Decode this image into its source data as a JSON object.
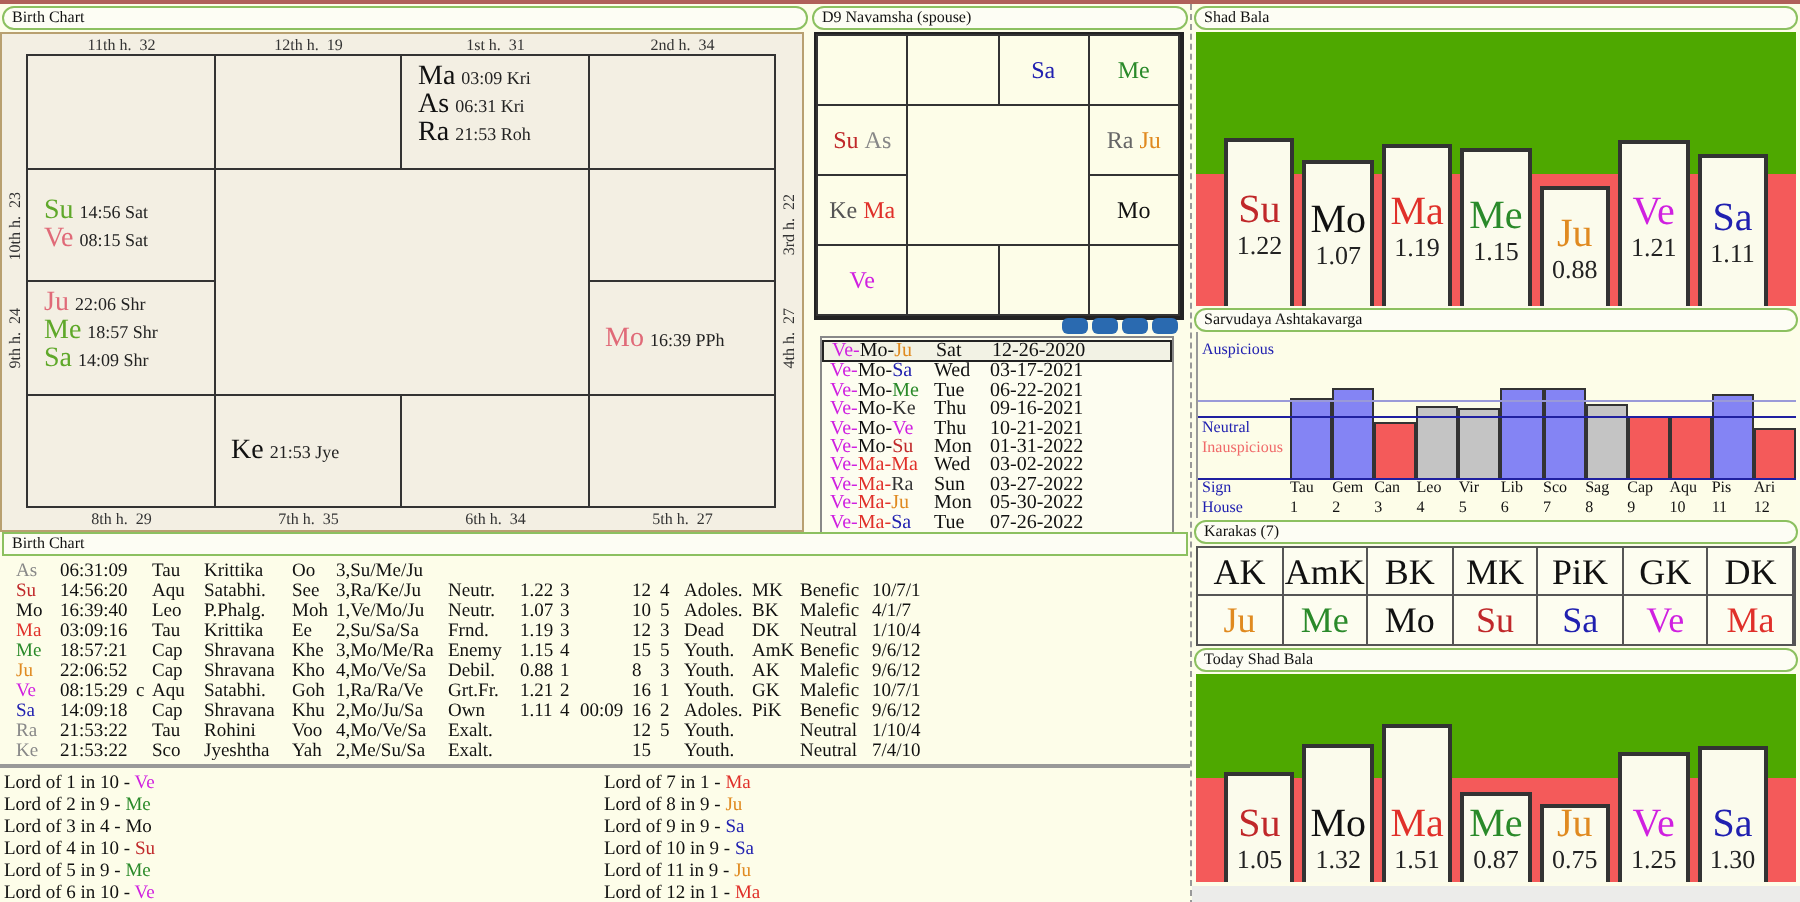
{
  "birth_chart": {
    "title": "Birth Chart",
    "houses": [
      {
        "label": "11th h.  32"
      },
      {
        "label": "12th h.  19"
      },
      {
        "label": "1st h.  31",
        "planets": [
          {
            "abbr": "Ma",
            "detail": "03:09 Kri",
            "color": "#111111"
          },
          {
            "abbr": "As",
            "detail": "06:31 Kri",
            "color": "#111111"
          },
          {
            "abbr": "Ra",
            "detail": "21:53 Roh",
            "color": "#111111"
          }
        ]
      },
      {
        "label": "2nd h.  34"
      },
      {
        "label": "10th h.  23",
        "planets": [
          {
            "abbr": "Su",
            "detail": "14:56 Sat",
            "color": "#5fa82a"
          },
          {
            "abbr": "Ve",
            "detail": "08:15 Sat",
            "color": "#e06a78"
          }
        ]
      },
      {
        "label": "3rd h.  22"
      },
      {
        "label": "9th h.  24",
        "planets": [
          {
            "abbr": "Ju",
            "detail": "22:06 Shr",
            "color": "#e06a78"
          },
          {
            "abbr": "Me",
            "detail": "18:57 Shr",
            "color": "#5fa82a"
          },
          {
            "abbr": "Sa",
            "detail": "14:09 Shr",
            "color": "#5fa82a"
          }
        ]
      },
      {
        "label": "4th h.  27",
        "planets": [
          {
            "abbr": "Mo",
            "detail": "16:39 PPh",
            "color": "#e06a78"
          }
        ]
      },
      {
        "label": "8th h.  29"
      },
      {
        "label": "7th h.  35",
        "planets": [
          {
            "abbr": "Ke",
            "detail": "21:53 Jye",
            "color": "#111111"
          }
        ]
      },
      {
        "label": "6th h.  34"
      },
      {
        "label": "5th h.  27"
      }
    ]
  },
  "navamsha": {
    "title": "D9 Navamsha  (spouse)",
    "houses": [
      {
        "planets": [
          {
            "abbr": "Sa",
            "color": "#2020b0"
          }
        ]
      },
      {
        "planets": [
          {
            "abbr": "Me",
            "color": "#2a8a2a"
          }
        ]
      },
      {
        "planets": [
          {
            "abbr": "Su",
            "color": "#c0282a"
          },
          {
            "abbr": "As",
            "color": "#888888"
          }
        ]
      },
      {
        "planets": [
          {
            "abbr": "Ra",
            "color": "#666666"
          },
          {
            "abbr": "Ju",
            "color": "#e08a20"
          }
        ]
      },
      {
        "planets": [
          {
            "abbr": "Ke",
            "color": "#555555"
          },
          {
            "abbr": "Ma",
            "color": "#e0302a"
          }
        ]
      },
      {
        "planets": [
          {
            "abbr": "Mo",
            "color": "#111111"
          }
        ]
      },
      {
        "planets": [
          {
            "abbr": "Ve",
            "color": "#d020e0"
          }
        ]
      }
    ]
  },
  "dasha": {
    "rows": [
      {
        "selected": true,
        "lords": [
          {
            "abbr": "Ve-",
            "color": "#d020e0"
          },
          {
            "abbr": "Mo-",
            "color": "#111111"
          },
          {
            "abbr": "Ju",
            "color": "#e08a20"
          }
        ],
        "day": "Sat",
        "date": "12-26-2020"
      },
      {
        "selected": false,
        "lords": [
          {
            "abbr": "Ve-",
            "color": "#d020e0"
          },
          {
            "abbr": "Mo-",
            "color": "#111111"
          },
          {
            "abbr": "Sa",
            "color": "#2020b0"
          }
        ],
        "day": "Wed",
        "date": "03-17-2021"
      },
      {
        "selected": false,
        "lords": [
          {
            "abbr": "Ve-",
            "color": "#d020e0"
          },
          {
            "abbr": "Mo-",
            "color": "#111111"
          },
          {
            "abbr": "Me",
            "color": "#2a8a2a"
          }
        ],
        "day": "Tue",
        "date": "06-22-2021"
      },
      {
        "selected": false,
        "lords": [
          {
            "abbr": "Ve-",
            "color": "#d020e0"
          },
          {
            "abbr": "Mo-",
            "color": "#111111"
          },
          {
            "abbr": "Ke",
            "color": "#333333"
          }
        ],
        "day": "Thu",
        "date": "09-16-2021"
      },
      {
        "selected": false,
        "lords": [
          {
            "abbr": "Ve-",
            "color": "#d020e0"
          },
          {
            "abbr": "Mo-",
            "color": "#111111"
          },
          {
            "abbr": "Ve",
            "color": "#d020e0"
          }
        ],
        "day": "Thu",
        "date": "10-21-2021"
      },
      {
        "selected": false,
        "lords": [
          {
            "abbr": "Ve-",
            "color": "#d020e0"
          },
          {
            "abbr": "Mo-",
            "color": "#111111"
          },
          {
            "abbr": "Su",
            "color": "#c0282a"
          }
        ],
        "day": "Mon",
        "date": "01-31-2022"
      },
      {
        "selected": false,
        "lords": [
          {
            "abbr": "Ve-",
            "color": "#d020e0"
          },
          {
            "abbr": "Ma-",
            "color": "#e0302a"
          },
          {
            "abbr": "Ma",
            "color": "#e0302a"
          }
        ],
        "day": "Wed",
        "date": "03-02-2022"
      },
      {
        "selected": false,
        "lords": [
          {
            "abbr": "Ve-",
            "color": "#d020e0"
          },
          {
            "abbr": "Ma-",
            "color": "#e0302a"
          },
          {
            "abbr": "Ra",
            "color": "#333333"
          }
        ],
        "day": "Sun",
        "date": "03-27-2022"
      },
      {
        "selected": false,
        "lords": [
          {
            "abbr": "Ve-",
            "color": "#d020e0"
          },
          {
            "abbr": "Ma-",
            "color": "#e0302a"
          },
          {
            "abbr": "Ju",
            "color": "#e08a20"
          }
        ],
        "day": "Mon",
        "date": "05-30-2022"
      },
      {
        "selected": false,
        "lords": [
          {
            "abbr": "Ve-",
            "color": "#d020e0"
          },
          {
            "abbr": "Ma-",
            "color": "#e0302a"
          },
          {
            "abbr": "Sa",
            "color": "#2020b0"
          }
        ],
        "day": "Tue",
        "date": "07-26-2022"
      }
    ]
  },
  "shad_bala": {
    "title": "Shad Bala",
    "bars": [
      {
        "abbr": "Su",
        "value": "1.22",
        "level": 0.61,
        "color": "#c0282a"
      },
      {
        "abbr": "Mo",
        "value": "1.07",
        "level": 0.535,
        "color": "#111111"
      },
      {
        "abbr": "Ma",
        "value": "1.19",
        "level": 0.595,
        "color": "#e0302a"
      },
      {
        "abbr": "Me",
        "value": "1.15",
        "level": 0.575,
        "color": "#2a8a2a"
      },
      {
        "abbr": "Ju",
        "value": "0.88",
        "level": 0.44,
        "color": "#e08a20"
      },
      {
        "abbr": "Ve",
        "value": "1.21",
        "level": 0.605,
        "color": "#d020e0"
      },
      {
        "abbr": "Sa",
        "value": "1.11",
        "level": 0.555,
        "color": "#2020b0"
      }
    ]
  },
  "ashtakavarga": {
    "title": "Sarvudaya Ashtakavarga",
    "zones": [
      "Auspicious",
      "Neutral",
      "Inauspicious"
    ],
    "sign_label": "Sign",
    "house_label": "House",
    "bars": [
      {
        "sign": "Tau",
        "house": "1",
        "kind": "auspicious",
        "level": 0.55
      },
      {
        "sign": "Gem",
        "house": "2",
        "kind": "auspicious",
        "level": 0.61
      },
      {
        "sign": "Can",
        "house": "3",
        "kind": "inauspicious",
        "level": 0.39
      },
      {
        "sign": "Leo",
        "house": "4",
        "kind": "neutral",
        "level": 0.49
      },
      {
        "sign": "Vir",
        "house": "5",
        "kind": "neutral",
        "level": 0.48
      },
      {
        "sign": "Lib",
        "house": "6",
        "kind": "auspicious",
        "level": 0.61
      },
      {
        "sign": "Sco",
        "house": "7",
        "kind": "auspicious",
        "level": 0.62
      },
      {
        "sign": "Sag",
        "house": "8",
        "kind": "neutral",
        "level": 0.51
      },
      {
        "sign": "Cap",
        "house": "9",
        "kind": "inauspicious",
        "level": 0.43
      },
      {
        "sign": "Aqu",
        "house": "10",
        "kind": "inauspicious",
        "level": 0.42
      },
      {
        "sign": "Pis",
        "house": "11",
        "kind": "auspicious",
        "level": 0.58
      },
      {
        "sign": "Ari",
        "house": "12",
        "kind": "inauspicious",
        "level": 0.34
      }
    ]
  },
  "karakas": {
    "title": "Karakas (7)",
    "items": [
      {
        "label": "AK",
        "planet": "Ju",
        "color": "#e08a20"
      },
      {
        "label": "AmK",
        "planet": "Me",
        "color": "#2a8a2a"
      },
      {
        "label": "BK",
        "planet": "Mo",
        "color": "#111111"
      },
      {
        "label": "MK",
        "planet": "Su",
        "color": "#c0282a"
      },
      {
        "label": "PiK",
        "planet": "Sa",
        "color": "#2020b0"
      },
      {
        "label": "GK",
        "planet": "Ve",
        "color": "#d020e0"
      },
      {
        "label": "DK",
        "planet": "Ma",
        "color": "#e0302a"
      }
    ]
  },
  "today_shad_bala": {
    "title": "Today Shad Bala",
    "bars": [
      {
        "abbr": "Su",
        "value": "1.05",
        "level": 0.525,
        "color": "#c0282a"
      },
      {
        "abbr": "Mo",
        "value": "1.32",
        "level": 0.66,
        "color": "#111111"
      },
      {
        "abbr": "Ma",
        "value": "1.51",
        "level": 0.755,
        "color": "#e0302a"
      },
      {
        "abbr": "Me",
        "value": "0.87",
        "level": 0.435,
        "color": "#2a8a2a"
      },
      {
        "abbr": "Ju",
        "value": "0.75",
        "level": 0.375,
        "color": "#e08a20"
      },
      {
        "abbr": "Ve",
        "value": "1.25",
        "level": 0.625,
        "color": "#d020e0"
      },
      {
        "abbr": "Sa",
        "value": "1.30",
        "level": 0.65,
        "color": "#2020b0"
      }
    ]
  },
  "planet_table": {
    "title": "Birth Chart",
    "rows": [
      {
        "planet": "As",
        "color": "#888888",
        "degree": "06:31:09",
        "sign": "Tau",
        "nakshatra": "Krittika",
        "syllable": "Oo",
        "pada_lords": "3,Su/Me/Ju"
      },
      {
        "planet": "Su",
        "color": "#c0282a",
        "degree": "14:56:20",
        "sign": "Aqu",
        "nakshatra": "Satabhi.",
        "syllable": "See",
        "pada_lords": "3,Ra/Ke/Ju",
        "dignity": "Neutr.",
        "strength": "1.22",
        "column_10": "3",
        "column_12": "12",
        "column_13": "4",
        "age": "Adoles.",
        "karaka": "MK",
        "nature": "Benefic",
        "houses": "10/7/1"
      },
      {
        "planet": "Mo",
        "color": "#111111",
        "degree": "16:39:40",
        "sign": "Leo",
        "nakshatra": "P.Phalg.",
        "syllable": "Moh",
        "pada_lords": "1,Ve/Mo/Ju",
        "dignity": "Neutr.",
        "strength": "1.07",
        "column_10": "3",
        "column_12": "10",
        "column_13": "5",
        "age": "Adoles.",
        "karaka": "BK",
        "nature": "Malefic",
        "houses": "4/1/7"
      },
      {
        "planet": "Ma",
        "color": "#e0302a",
        "degree": "03:09:16",
        "sign": "Tau",
        "nakshatra": "Krittika",
        "syllable": "Ee",
        "pada_lords": "2,Su/Sa/Sa",
        "dignity": "Frnd.",
        "strength": "1.19",
        "column_10": "3",
        "column_12": "12",
        "column_13": "3",
        "age": "Dead",
        "karaka": "DK",
        "nature": "Neutral",
        "houses": "1/10/4"
      },
      {
        "planet": "Me",
        "color": "#2a8a2a",
        "degree": "18:57:21",
        "sign": "Cap",
        "nakshatra": "Shravana",
        "syllable": "Khe",
        "pada_lords": "3,Mo/Me/Ra",
        "dignity": "Enemy",
        "strength": "1.15",
        "column_10": "4",
        "column_12": "15",
        "column_13": "5",
        "age": "Youth.",
        "karaka": "AmK",
        "nature": "Benefic",
        "houses": "9/6/12"
      },
      {
        "planet": "Ju",
        "color": "#e08a20",
        "degree": "22:06:52",
        "sign": "Cap",
        "nakshatra": "Shravana",
        "syllable": "Kho",
        "pada_lords": "4,Mo/Ve/Sa",
        "dignity": "Debil.",
        "strength": "0.88",
        "column_10": "1",
        "column_12": "8",
        "column_13": "3",
        "age": "Youth.",
        "karaka": "AK",
        "nature": "Malefic",
        "houses": "9/6/12"
      },
      {
        "planet": "Ve",
        "color": "#d020e0",
        "degree": "08:15:29",
        "retro": "c",
        "sign": "Aqu",
        "nakshatra": "Satabhi.",
        "syllable": "Goh",
        "pada_lords": "1,Ra/Ra/Ve",
        "dignity": "Grt.Fr.",
        "strength": "1.21",
        "column_10": "2",
        "column_12": "16",
        "column_13": "1",
        "age": "Youth.",
        "karaka": "GK",
        "nature": "Malefic",
        "houses": "10/7/1"
      },
      {
        "planet": "Sa",
        "color": "#2020b0",
        "degree": "14:09:18",
        "sign": "Cap",
        "nakshatra": "Shravana",
        "syllable": "Khu",
        "pada_lords": "2,Mo/Ju/Sa",
        "dignity": "Own",
        "strength": "1.11",
        "column_10": "4",
        "column_11": "00:09",
        "column_12": "16",
        "column_13": "2",
        "age": "Adoles.",
        "karaka": "PiK",
        "nature": "Benefic",
        "houses": "9/6/12"
      },
      {
        "planet": "Ra",
        "color": "#888888",
        "degree": "21:53:22",
        "sign": "Tau",
        "nakshatra": "Rohini",
        "syllable": "Voo",
        "pada_lords": "4,Mo/Ve/Sa",
        "dignity": "Exalt.",
        "column_12": "12",
        "column_13": "5",
        "age": "Youth.",
        "nature": "Neutral",
        "houses": "1/10/4"
      },
      {
        "planet": "Ke",
        "color": "#888888",
        "degree": "21:53:22",
        "sign": "Sco",
        "nakshatra": "Jyeshtha",
        "syllable": "Yah",
        "pada_lords": "2,Me/Su/Sa",
        "dignity": "Exalt.",
        "column_12": "15",
        "age": "Youth.",
        "nature": "Neutral",
        "houses": "7/4/10"
      }
    ]
  },
  "lords": [
    [
      {
        "text": "Lord of 1 in 10 - ",
        "planet": "Ve",
        "color": "#d020e0"
      },
      {
        "text": "Lord of 2 in 9 - ",
        "planet": "Me",
        "color": "#2a8a2a"
      },
      {
        "text": "Lord of 3 in 4 - ",
        "planet": "Mo",
        "color": "#111111"
      },
      {
        "text": "Lord of 4 in 10 - ",
        "planet": "Su",
        "color": "#c0282a"
      },
      {
        "text": "Lord of 5 in 9 - ",
        "planet": "Me",
        "color": "#2a8a2a"
      },
      {
        "text": "Lord of 6 in 10 - ",
        "planet": "Ve",
        "color": "#d020e0"
      }
    ],
    [
      {
        "text": "Lord of 7 in 1 - ",
        "planet": "Ma",
        "color": "#e0302a"
      },
      {
        "text": "Lord of 8 in 9 - ",
        "planet": "Ju",
        "color": "#e08a20"
      },
      {
        "text": "Lord of 9 in 9 - ",
        "planet": "Sa",
        "color": "#2020b0"
      },
      {
        "text": "Lord of 10 in 9 - ",
        "planet": "Sa",
        "color": "#2020b0"
      },
      {
        "text": "Lord of 11 in 9 - ",
        "planet": "Ju",
        "color": "#e08a20"
      },
      {
        "text": "Lord of 12 in 1 - ",
        "planet": "Ma",
        "color": "#e0302a"
      }
    ]
  ]
}
